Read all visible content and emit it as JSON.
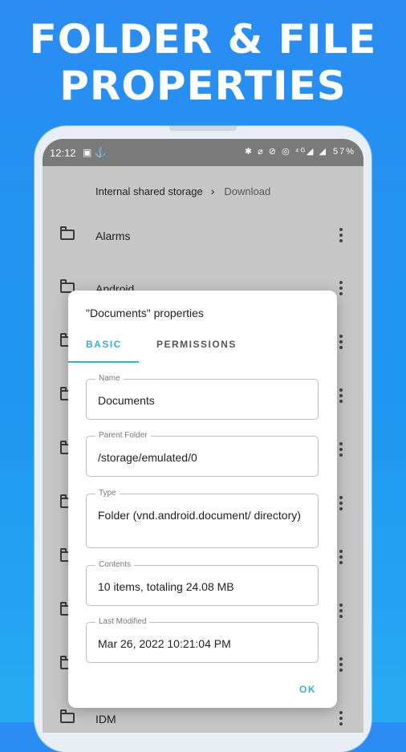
{
  "promo": {
    "line1": "FOLDER & FILE",
    "line2": "PROPERTIES"
  },
  "status_bar": {
    "time": "12:12",
    "left_icons": "▣ ⚓",
    "right_icons": "✱ ⌀ ⊘ ◎ ⁴ᴳ◢ ◢",
    "battery": "57%"
  },
  "breadcrumb": {
    "root": "Internal shared storage",
    "separator": "›",
    "current": "Download"
  },
  "files": {
    "rows": [
      {
        "name": "Alarms"
      },
      {
        "name": "Android"
      },
      {
        "name": ""
      },
      {
        "name": ""
      },
      {
        "name": ""
      },
      {
        "name": ""
      },
      {
        "name": ""
      },
      {
        "name": ""
      },
      {
        "name": ""
      },
      {
        "name": "IDM"
      }
    ]
  },
  "dialog": {
    "title": "\"Documents\" properties",
    "tabs": {
      "basic": "BASIC",
      "permissions": "PERMISSIONS"
    },
    "fields": {
      "name": {
        "label": "Name",
        "value": "Documents"
      },
      "parent": {
        "label": "Parent Folder",
        "value": "/storage/emulated/0"
      },
      "type": {
        "label": "Type",
        "value": "Folder (vnd.android.document/ directory)"
      },
      "contents": {
        "label": "Contents",
        "value": "10 items, totaling 24.08 MB"
      },
      "modified": {
        "label": "Last Modified",
        "value": "Mar 26, 2022 10:21:04 PM"
      }
    },
    "ok_label": "OK",
    "accent_color": "#33b0da"
  }
}
